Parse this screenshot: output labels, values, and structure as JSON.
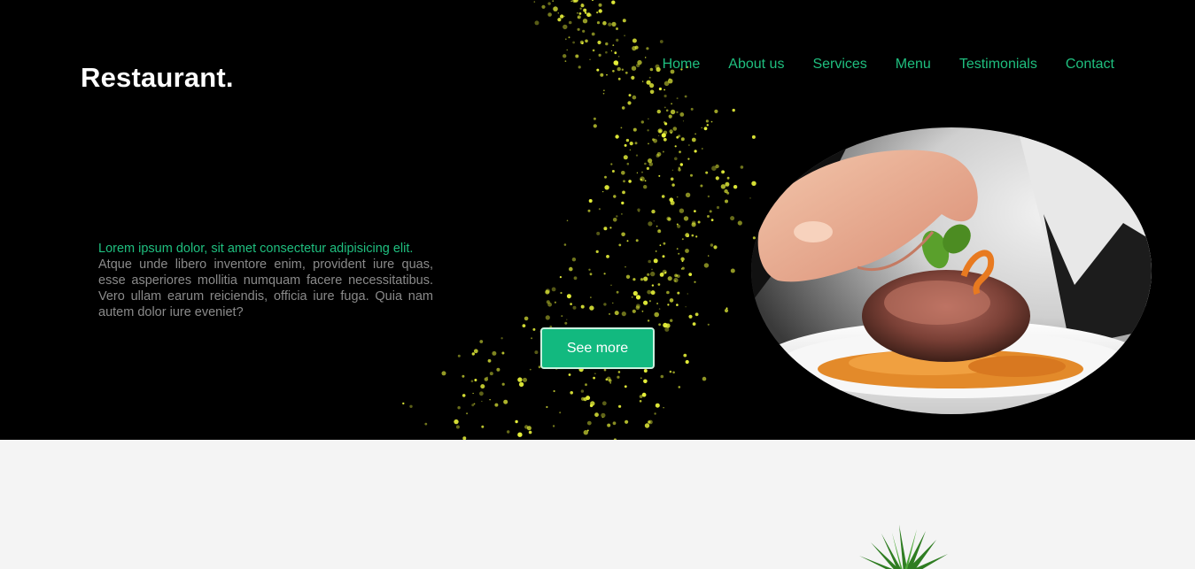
{
  "header": {
    "logo": "Restaurant.",
    "nav": [
      "Home",
      "About us",
      "Services",
      "Menu",
      "Testimonials",
      "Contact"
    ]
  },
  "hero": {
    "lead": "Lorem ipsum dolor, sit amet consectetur adipisicing elit.",
    "body": "Atque unde libero inventore enim, provident iure quas, esse asperiores mollitia numquam facere necessitatibus. Vero ullam earum reiciendis, officia iure fuga. Quia nam autem dolor iure eveniet?",
    "cta": "See more"
  },
  "colors": {
    "accent": "#1fbf7f",
    "button": "#12b97f",
    "hero_bg": "#000000",
    "section_bg": "#f4f4f4",
    "sparkle": "#e8f23a"
  }
}
